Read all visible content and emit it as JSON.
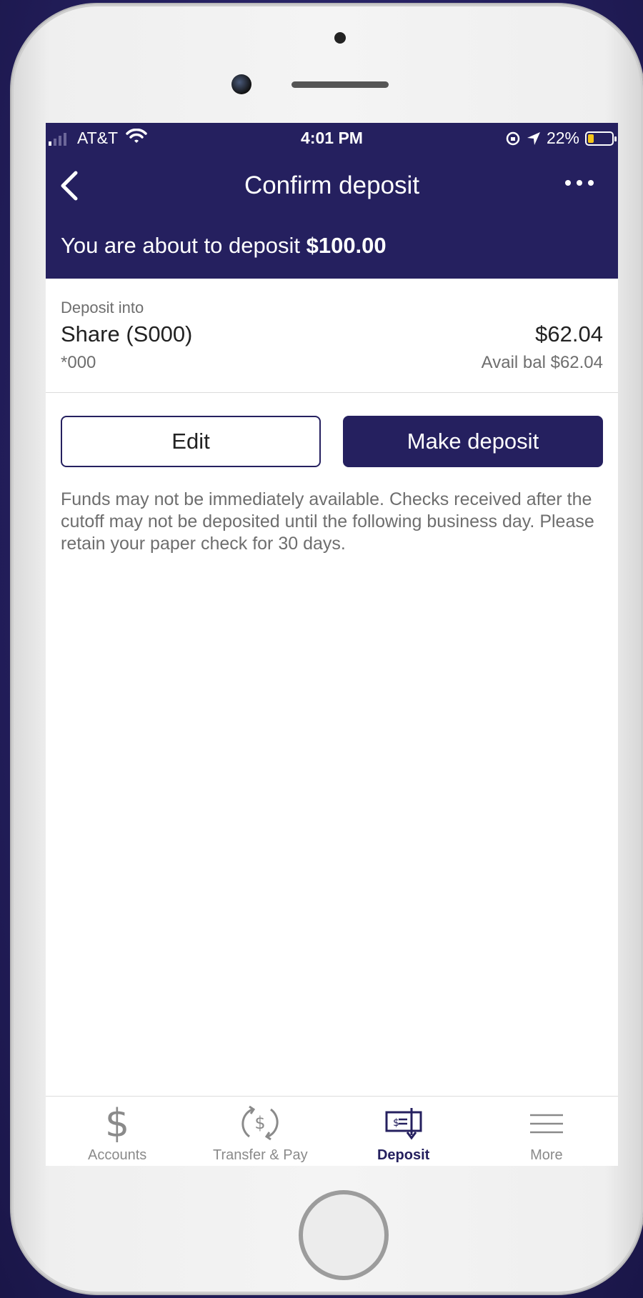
{
  "status_bar": {
    "carrier": "AT&T",
    "time": "4:01 PM",
    "battery_percent": "22%",
    "battery_level": 0.22
  },
  "nav": {
    "title": "Confirm deposit"
  },
  "summary": {
    "prefix": "You are about to deposit",
    "amount": "$100.00"
  },
  "account": {
    "label": "Deposit into",
    "name": "Share (S000)",
    "number": "*000",
    "balance": "$62.04",
    "available": "Avail bal $62.04"
  },
  "actions": {
    "edit_label": "Edit",
    "make_deposit_label": "Make deposit"
  },
  "disclaimer": "Funds may not be immediately available. Checks received after the cutoff may not be deposited until the following business day. Please retain your paper check for 30 days.",
  "tabs": [
    {
      "label": "Accounts",
      "icon": "dollar-icon",
      "active": false
    },
    {
      "label": "Transfer & Pay",
      "icon": "transfer-icon",
      "active": false
    },
    {
      "label": "Deposit",
      "icon": "check-deposit-icon",
      "active": true
    },
    {
      "label": "More",
      "icon": "menu-icon",
      "active": false
    }
  ],
  "colors": {
    "brand": "#25205f",
    "battery": "#f5c518"
  }
}
